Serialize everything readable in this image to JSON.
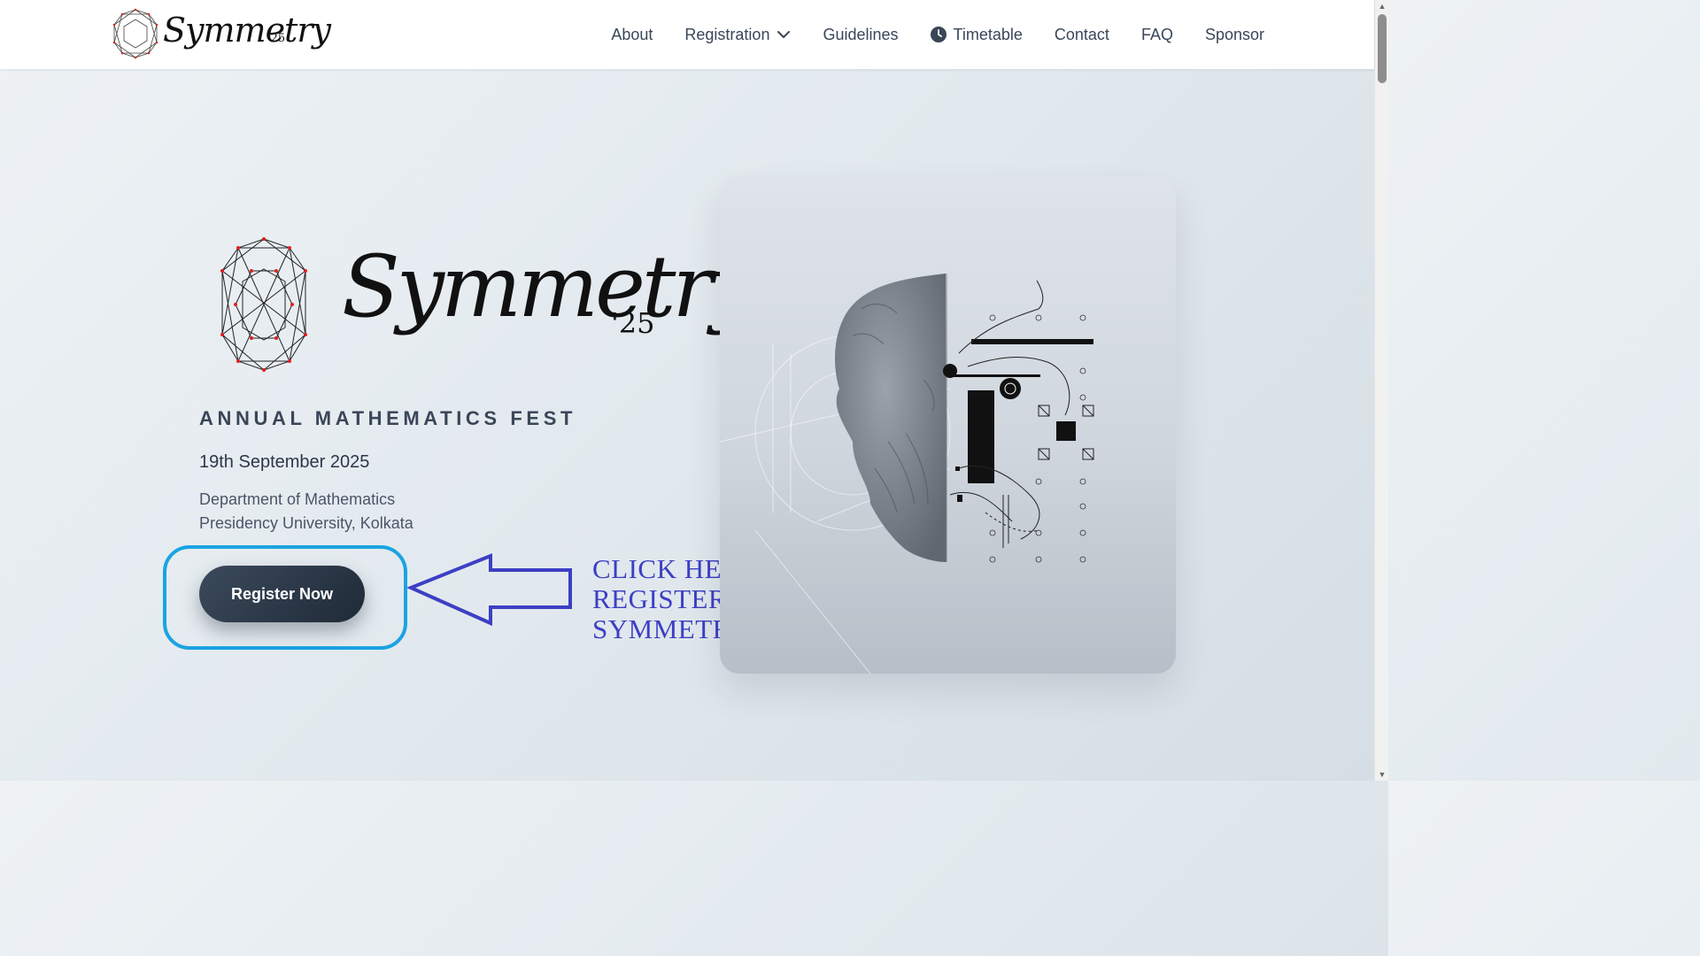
{
  "header": {
    "brand_word": "Symmetry",
    "brand_year": "'25",
    "nav": [
      {
        "label": "About"
      },
      {
        "label": "Registration",
        "icon": "chevron-down-icon"
      },
      {
        "label": "Guidelines"
      },
      {
        "label": "Timetable",
        "icon": "clock-icon"
      },
      {
        "label": "Contact"
      },
      {
        "label": "FAQ"
      },
      {
        "label": "Sponsor"
      }
    ]
  },
  "hero": {
    "word": "Symmetry",
    "year": "'25",
    "tagline": "ANNUAL MATHEMATICS FEST",
    "date": "19th September 2025",
    "dept_line1": "Department of Mathematics",
    "dept_line2": "Presidency University, Kolkata",
    "register_label": "Register Now",
    "callout_line1": "CLICK HERE TO",
    "callout_line2": "REGISTER FOR",
    "callout_line3": "SYMMETRY"
  },
  "colors": {
    "accent_ring": "#1ba3e2",
    "callout": "#3d3fc4",
    "button": "#2a3644"
  }
}
